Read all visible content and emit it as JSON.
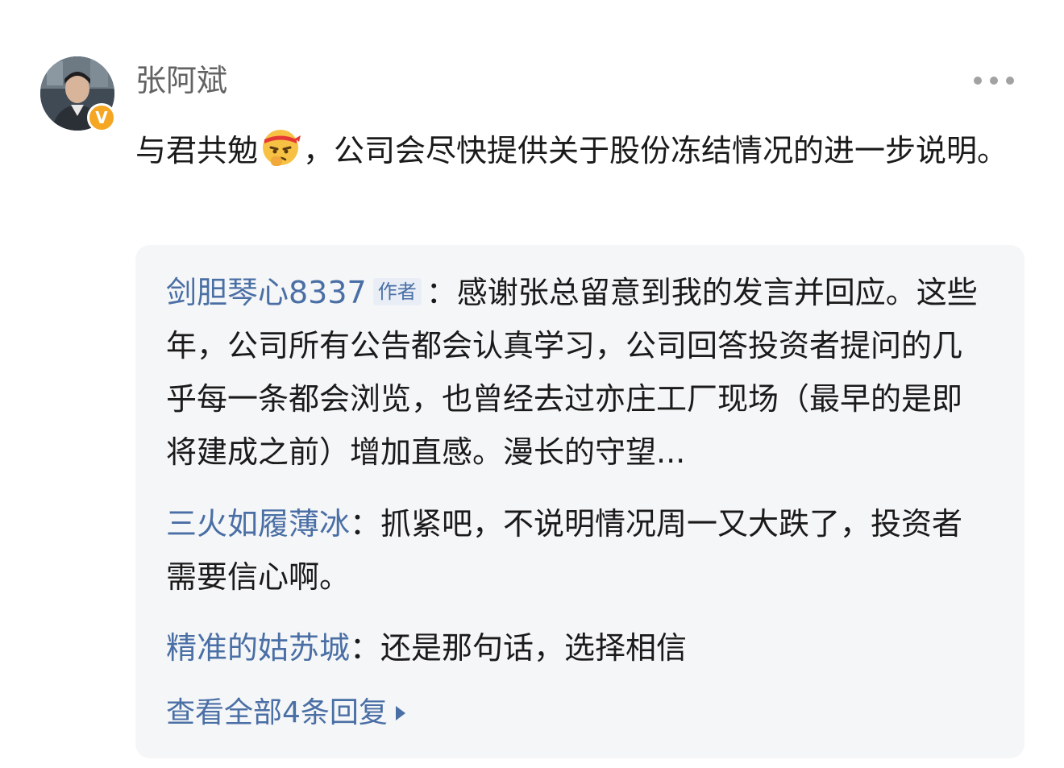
{
  "comment": {
    "author": {
      "name": "张阿斌",
      "badge": "V",
      "avatar_icon": "user-photo-avatar",
      "badge_color": "#f5a623"
    },
    "more_icon": "ellipsis-icon",
    "text_before_emoji": "与君共勉",
    "emoji_icon": "determined-face-emoji",
    "text_after_emoji": "，公司会尽快提供关于股份冻结情况的进一步说明。"
  },
  "replies": [
    {
      "author": "剑胆琴心8337",
      "tag": "作者",
      "separator": "：",
      "text": "感谢张总留意到我的发言并回应。这些年，公司所有公告都会认真学习，公司回答投资者提问的几乎每一条都会浏览，也曾经去过亦庄工厂现场（最早的是即将建成之前）增加直感。漫长的守望..."
    },
    {
      "author": "三火如履薄冰",
      "separator": "：",
      "text": "抓紧吧，不说明情况周一又大跌了，投资者需要信心啊。"
    },
    {
      "author": "精准的姑苏城",
      "separator": "：",
      "text": "还是那句话，选择相信"
    }
  ],
  "view_all_replies": {
    "label": "查看全部4条回复",
    "icon": "caret-right-icon"
  },
  "colors": {
    "link_blue": "#4a6fa5",
    "reply_background": "#f5f6f8",
    "text": "#1a1a1a",
    "username_gray": "#636363"
  }
}
